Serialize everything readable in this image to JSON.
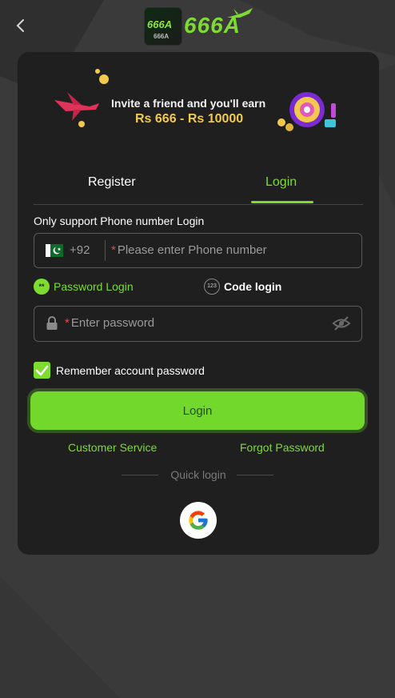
{
  "header": {
    "logo_badge_text": "666A",
    "logo_badge_subtext": "666A",
    "logo_text": "666A"
  },
  "banner": {
    "line1": "Invite a friend and you'll earn",
    "line2": "Rs 666 - Rs 10000"
  },
  "tabs": [
    {
      "label": "Register",
      "active": false
    },
    {
      "label": "Login",
      "active": true
    }
  ],
  "form": {
    "support_text": "Only support Phone number Login",
    "country_code": "+92",
    "phone_placeholder": "Please enter Phone number",
    "required_mark": "*",
    "login_modes": [
      {
        "icon_text": "**",
        "label": "Password Login",
        "selected": true
      },
      {
        "icon_text": "123",
        "label": "Code login",
        "selected": false
      }
    ],
    "password_placeholder": "Enter password",
    "remember_label": "Remember account password",
    "remember_checked": true,
    "login_button": "Login"
  },
  "links": {
    "customer_service": "Customer Service",
    "forgot_password": "Forgot Password"
  },
  "quick_login": {
    "label": "Quick login",
    "providers": [
      "google-icon"
    ]
  },
  "colors": {
    "accent": "#7ddc2f",
    "button": "#72d92c",
    "card": "#1f1f1f",
    "background": "#3a3a3a",
    "required": "#e24a4a"
  }
}
